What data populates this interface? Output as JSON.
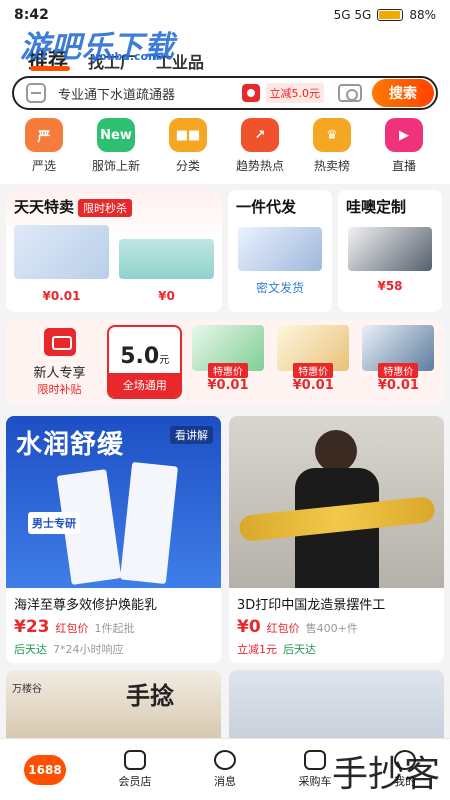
{
  "status_bar": {
    "time": "8:42",
    "battery": "88%",
    "network": "5G 5G",
    "battery_level": 0.88
  },
  "watermark": {
    "text": "游吧乐下载",
    "sub": "youba.com"
  },
  "header": {
    "tabs": [
      {
        "label": "推荐"
      },
      {
        "label": "找工厂"
      },
      {
        "label": "工业品"
      }
    ]
  },
  "search": {
    "query": "专业通下水道疏通器",
    "promo": "立减5.0元",
    "button": "搜索"
  },
  "categories": [
    {
      "label": "严选",
      "icon": "yanxuan-icon",
      "glyph": "严",
      "color": "#f57c3a"
    },
    {
      "label": "服饰上新",
      "icon": "new-shirt-icon",
      "glyph": "New",
      "color": "#2fbf71"
    },
    {
      "label": "分类",
      "icon": "category-grid-icon",
      "glyph": "■■",
      "color": "#f5a623"
    },
    {
      "label": "趋势热点",
      "icon": "trend-icon",
      "glyph": "↗",
      "color": "#f0532c"
    },
    {
      "label": "热卖榜",
      "icon": "trophy-icon",
      "glyph": "♛",
      "color": "#f5a623"
    },
    {
      "label": "直播",
      "icon": "live-icon",
      "glyph": "▶",
      "color": "#f0327c"
    }
  ],
  "promo_cards": {
    "daily": {
      "title": "天天特卖",
      "badge": "限时秒杀",
      "items": [
        {
          "price": "¥0.01"
        },
        {
          "price": "¥0"
        }
      ]
    },
    "dropship": {
      "title": "一件代发",
      "caption": "密文发货"
    },
    "custom": {
      "title": "哇噢定制",
      "price": "¥58"
    }
  },
  "newcomer": {
    "title": "新人专享",
    "subtitle": "限时补贴",
    "coupon_amount": "5.0",
    "coupon_unit": "元",
    "coupon_scope": "全场通用",
    "deals": [
      {
        "tag": "特惠价",
        "price": "¥0.01"
      },
      {
        "tag": "特惠价",
        "price": "¥0.01"
      },
      {
        "tag": "特惠价",
        "price": "¥0.01"
      }
    ]
  },
  "feed": [
    {
      "image_headline": "水润舒缓",
      "image_badge": "看讲解",
      "image_label": "男士专研",
      "title": "海洋至尊多效修护焕能乳",
      "price": "¥23",
      "tag": "红包价",
      "meta": "1件起批",
      "foot_tag": "后天达",
      "foot_note": "7*24小时响应"
    },
    {
      "title": "3D打印中国龙造景摆件工",
      "price": "¥0",
      "tag": "红包价",
      "meta": "售400+件",
      "foot_tag": "立减1元",
      "foot_note": "后天达"
    }
  ],
  "feed_next": [
    {
      "image_text": "手捻",
      "brand": "万楼谷"
    },
    {
      "image_text": ""
    }
  ],
  "bottom_nav": [
    {
      "label": "1688"
    },
    {
      "label": "会员店"
    },
    {
      "label": "消息"
    },
    {
      "label": "采购车"
    },
    {
      "label": "我的"
    }
  ],
  "bottom_watermark": "手抄客"
}
